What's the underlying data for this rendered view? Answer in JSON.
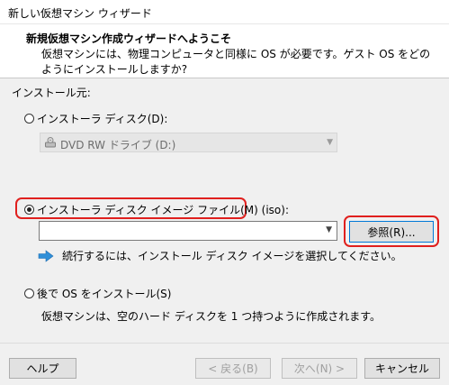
{
  "window": {
    "title": "新しい仮想マシン ウィザード"
  },
  "header": {
    "title": "新規仮想マシン作成ウィザードへようこそ",
    "description": "仮想マシンには、物理コンピュータと同様に OS が必要です。ゲスト OS をどのようにインストールしますか?"
  },
  "section": {
    "label": "インストール元:"
  },
  "options": {
    "disc": {
      "label": "インストーラ ディスク(D):",
      "selected": false
    },
    "drive": {
      "value": "DVD RW ドライブ (D:)",
      "icon": "dvd-drive-icon"
    },
    "iso": {
      "label": "インストーラ ディスク イメージ ファイル(M) (iso):",
      "selected": true
    },
    "iso_path": {
      "value": ""
    },
    "browse": {
      "label": "参照(R)..."
    },
    "hint": {
      "text": "続行するには、インストール ディスク イメージを選択してください。",
      "icon": "arrow-right-icon"
    },
    "later": {
      "label": "後で OS をインストール(S)",
      "selected": false
    },
    "later_desc": {
      "text": "仮想マシンは、空のハード ディスクを 1 つ持つように作成されます。"
    }
  },
  "footer": {
    "help": "ヘルプ",
    "back": "< 戻る(B)",
    "next": "次へ(N) >",
    "cancel": "キャンセル"
  },
  "colors": {
    "highlight": "#e0201e",
    "hint_arrow": "#2f8fd8",
    "default_button_border": "#0078d7"
  }
}
